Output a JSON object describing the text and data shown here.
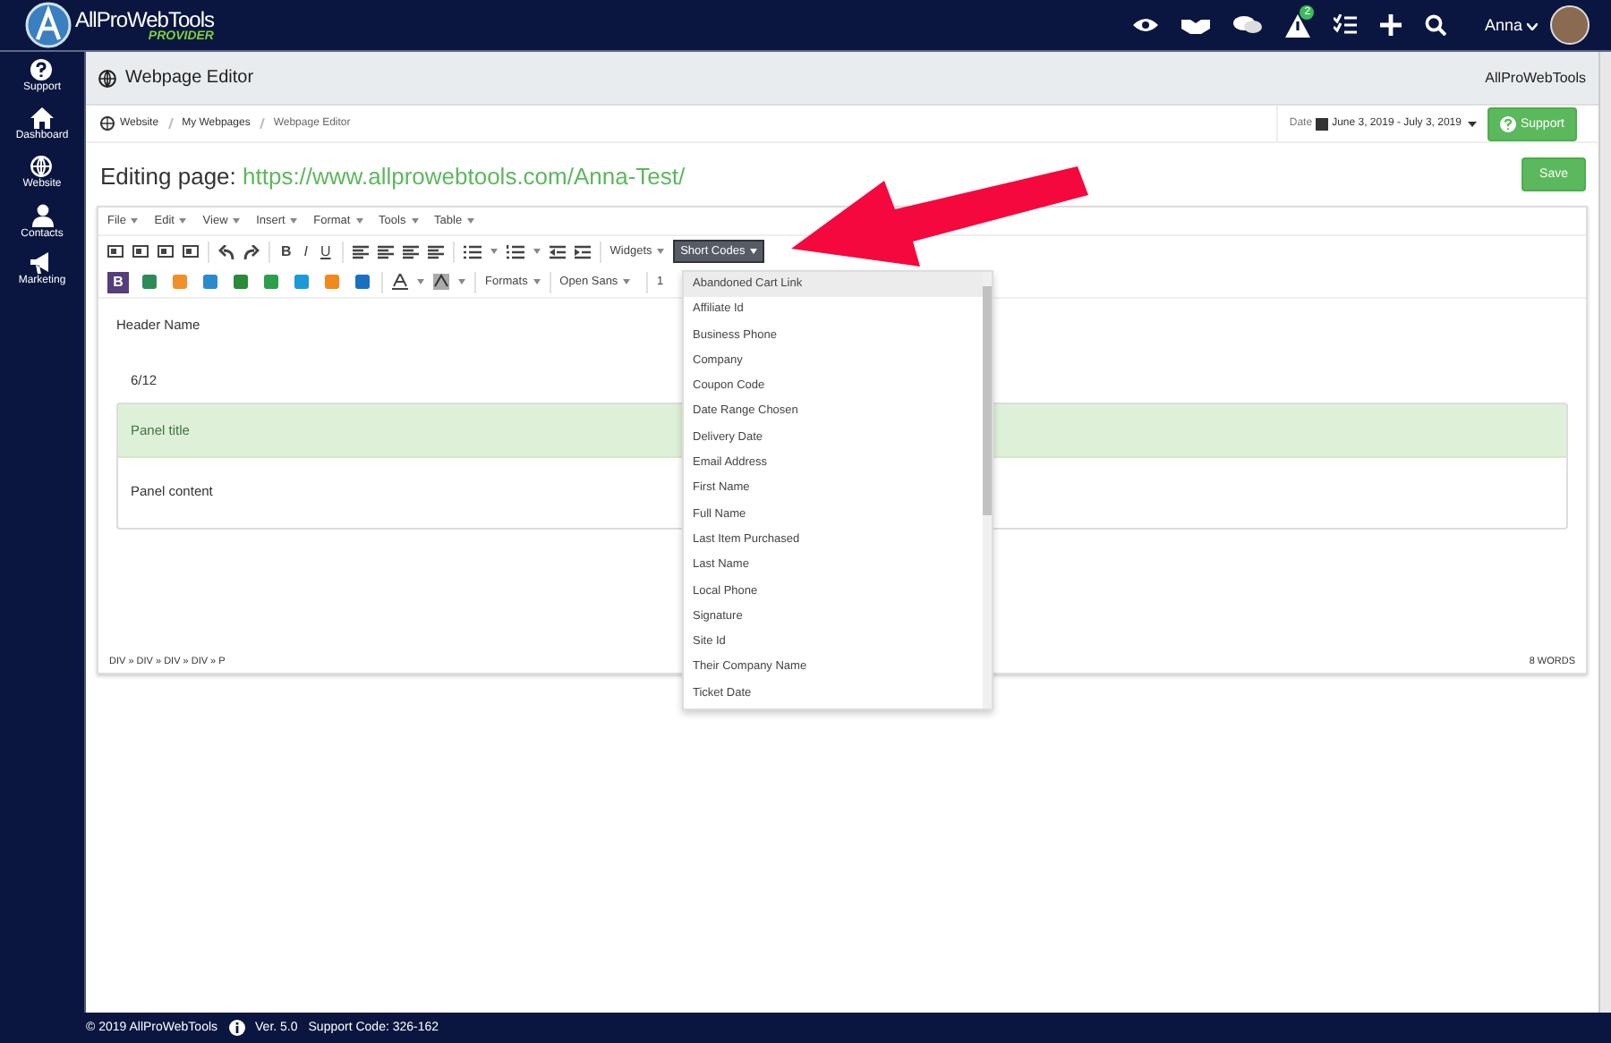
{
  "top_bar": {
    "logo_name": "AllProWebTools",
    "logo_sub": "PROVIDER",
    "alert_badge": "2",
    "user": "Anna"
  },
  "sidebar": {
    "items": [
      {
        "label": "Support",
        "kind": "help"
      },
      {
        "label": "Dashboard",
        "kind": "home"
      },
      {
        "label": "Website",
        "kind": "globe"
      },
      {
        "label": "Contacts",
        "kind": "person"
      },
      {
        "label": "Marketing",
        "kind": "megaphone"
      }
    ]
  },
  "header": {
    "title": "Webpage Editor",
    "company": "AllProWebTools"
  },
  "breadcrumb": [
    "Website",
    "My Webpages",
    "Webpage Editor"
  ],
  "date_filter": {
    "label": "Date",
    "range": "June 3, 2019 - July 3, 2019"
  },
  "support_button": "Support",
  "page_title": {
    "prefix": "Editing page:",
    "url": "https://www.allprowebtools.com/Anna-Test/"
  },
  "save_button": "Save",
  "editor": {
    "menu": [
      "File",
      "Edit",
      "View",
      "Insert",
      "Format",
      "Tools",
      "Table"
    ],
    "format_buttons": [
      "B",
      "I",
      "U"
    ],
    "widgets": "Widgets",
    "short_codes": "Short Codes",
    "bootstrap_button": "B",
    "formats": "Formats",
    "font": "Open Sans",
    "font_size": "1",
    "content": {
      "heading": "Header Name",
      "column": "6/12",
      "panel_title": "Panel title",
      "panel_content": "Panel content"
    },
    "path": "DIV » DIV » DIV » DIV » P",
    "word_count": "8 WORDS"
  },
  "short_codes_menu": [
    {
      "label": "Abandoned Cart Link",
      "selected": true
    },
    {
      "label": "Affiliate Id",
      "selected": false
    },
    {
      "label": "Business Phone",
      "selected": false
    },
    {
      "label": "Company",
      "selected": false
    },
    {
      "label": "Coupon Code",
      "selected": false
    },
    {
      "label": "Date Range Chosen",
      "selected": false
    },
    {
      "label": "Delivery Date",
      "selected": false
    },
    {
      "label": "Email Address",
      "selected": false
    },
    {
      "label": "First Name",
      "selected": false
    },
    {
      "label": "Full Name",
      "selected": false
    },
    {
      "label": "Last Item Purchased",
      "selected": false
    },
    {
      "label": "Last Name",
      "selected": false
    },
    {
      "label": "Local Phone",
      "selected": false
    },
    {
      "label": "Signature",
      "selected": false
    },
    {
      "label": "Site Id",
      "selected": false
    },
    {
      "label": "Their Company Name",
      "selected": false
    },
    {
      "label": "Ticket Date",
      "selected": false
    }
  ],
  "footer": {
    "copyright": "© 2019 AllProWebTools",
    "version": "Ver. 5.0",
    "support_code": "Support Code: 326-162"
  }
}
